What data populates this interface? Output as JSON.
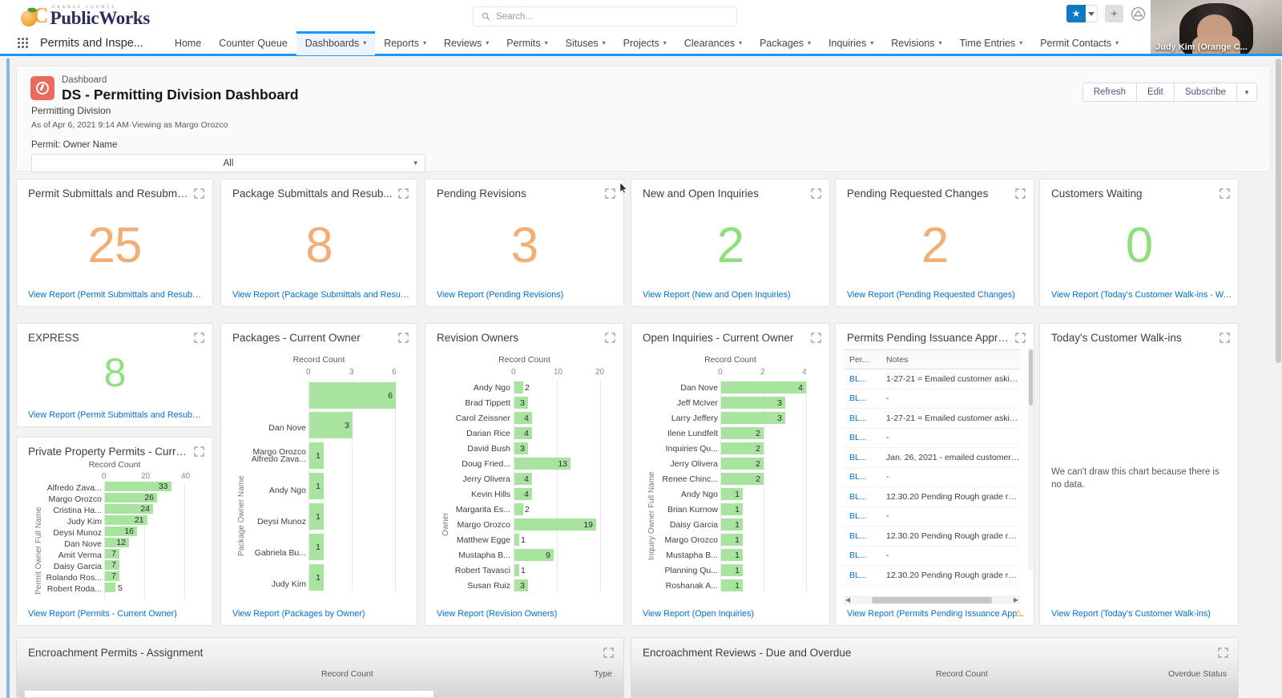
{
  "brand": {
    "sup": "ORANGE COUNTY",
    "name_part1": "Public",
    "name_part2": "Works",
    "c": "C"
  },
  "global_header": {
    "search_placeholder": "Search...",
    "icons": [
      "star-icon",
      "caret-down-icon",
      "plus-icon",
      "help-icon"
    ]
  },
  "video_overlay": {
    "participant": "Judy Kim (Orange C..."
  },
  "nav": {
    "app_name": "Permits and Inspe...",
    "items": [
      {
        "label": "Home",
        "has_caret": false,
        "active": false
      },
      {
        "label": "Counter Queue",
        "has_caret": false,
        "active": false
      },
      {
        "label": "Dashboards",
        "has_caret": true,
        "active": true
      },
      {
        "label": "Reports",
        "has_caret": true,
        "active": false
      },
      {
        "label": "Reviews",
        "has_caret": true,
        "active": false
      },
      {
        "label": "Permits",
        "has_caret": true,
        "active": false
      },
      {
        "label": "Situses",
        "has_caret": true,
        "active": false
      },
      {
        "label": "Projects",
        "has_caret": true,
        "active": false
      },
      {
        "label": "Clearances",
        "has_caret": true,
        "active": false
      },
      {
        "label": "Packages",
        "has_caret": true,
        "active": false
      },
      {
        "label": "Inquiries",
        "has_caret": true,
        "active": false
      },
      {
        "label": "Revisions",
        "has_caret": true,
        "active": false
      },
      {
        "label": "Time Entries",
        "has_caret": true,
        "active": false
      },
      {
        "label": "Permit Contacts",
        "has_caret": true,
        "active": false
      }
    ]
  },
  "dashboard_header": {
    "kicker": "Dashboard",
    "title": "DS - Permitting Division Dashboard",
    "folder": "Permitting Division",
    "meta": "As of Apr 6, 2021 9:14 AM·Viewing as Margo Orozco",
    "filter_label": "Permit: Owner Name",
    "filter_value": "All",
    "actions": {
      "refresh": "Refresh",
      "edit": "Edit",
      "subscribe": "Subscribe"
    }
  },
  "metrics": [
    {
      "title": "Permit Submittals and Resubmitt...",
      "value": "25",
      "color": "orange",
      "link": "View Report (Permit Submittals and Resubmittals)"
    },
    {
      "title": "Package Submittals and Resub...",
      "value": "8",
      "color": "orange",
      "link": "View Report (Package Submittals and Resubmitt..."
    },
    {
      "title": "Pending Revisions",
      "value": "3",
      "color": "orange",
      "link": "View Report (Pending Revisions)"
    },
    {
      "title": "New and Open Inquiries",
      "value": "2",
      "color": "green",
      "link": "View Report (New and Open Inquiries)"
    },
    {
      "title": "Pending Requested Changes",
      "value": "2",
      "color": "orange",
      "link": "View Report (Pending Requested Changes)"
    },
    {
      "title": "Customers Waiting",
      "value": "0",
      "color": "green",
      "link": "View Report (Today's Customer Walk-ins - Waiti..."
    }
  ],
  "express": {
    "title": "EXPRESS",
    "value": "8",
    "color": "green",
    "link": "View Report (Permit Submittals and Resubmittal..."
  },
  "no_data_message": "We can't draw this chart because there is no data.",
  "widgets": {
    "private_property": {
      "title": "Private Property Permits - Curre...",
      "link": "View Report (Permits - Current Owner)"
    },
    "packages": {
      "title": "Packages - Current Owner",
      "link": "View Report (Packages by Owner)"
    },
    "revisions": {
      "title": "Revision Owners",
      "link": "View Report (Revision Owners)"
    },
    "inquiries": {
      "title": "Open Inquiries - Current Owner",
      "link": "View Report (Open Inquiries)"
    },
    "pending_issuance": {
      "title": "Permits Pending Issuance Appro...",
      "link": "View Report (Permits Pending Issuance App..."
    },
    "walkins": {
      "title": "Today's Customer Walk-ins",
      "link": "View Report (Today's Customer Walk-ins)"
    }
  },
  "pending_issuance_table": {
    "columns": [
      "Per...",
      "Notes"
    ],
    "rows": [
      {
        "permit": "BL...",
        "notes": "1-27-21 = Emailed customer askin..."
      },
      {
        "permit": "BL...",
        "notes": "-"
      },
      {
        "permit": "BL...",
        "notes": "1-27-21 = Emailed customer askin..."
      },
      {
        "permit": "BL...",
        "notes": "-"
      },
      {
        "permit": "BL...",
        "notes": "Jan. 26, 2021 - emailed customer ..."
      },
      {
        "permit": "BL...",
        "notes": "-"
      },
      {
        "permit": "BL...",
        "notes": "12.30.20 Pending Rough grade rel..."
      },
      {
        "permit": "BL...",
        "notes": "-"
      },
      {
        "permit": "BL...",
        "notes": "12.30.20 Pending Rough grade rel..."
      },
      {
        "permit": "BL...",
        "notes": "-"
      },
      {
        "permit": "BL...",
        "notes": "12.30.20 Pending Rough grade rel..."
      }
    ]
  },
  "bottom_row": [
    {
      "title": "Encroachment Permits - Assignment",
      "metric": "Record Count",
      "group": "Type"
    },
    {
      "title": "Encroachment Reviews - Due and Overdue",
      "metric": "Record Count",
      "group": "Overdue Status"
    }
  ],
  "chart_data": [
    {
      "type": "bar",
      "title": "Private Property Permits - Curre...",
      "xlabel": "Record Count",
      "ylabel": "Permit Owner Full Name",
      "xlim": [
        0,
        40
      ],
      "ticks": [
        0,
        20,
        40
      ],
      "orientation": "horizontal",
      "categories": [
        "Alfredo Zava...",
        "Margo Orozco",
        "Cristina Ha...",
        "Judy Kim",
        "Deysi Munoz",
        "Dan Nove",
        "Amit Verma",
        "Daisy Garcia",
        "Rolando Ros...",
        "Robert Roda..."
      ],
      "values": [
        33,
        26,
        24,
        21,
        16,
        12,
        7,
        7,
        7,
        5
      ],
      "color": "#a8e3a0"
    },
    {
      "type": "bar",
      "title": "Packages - Current Owner",
      "xlabel": "Record Count",
      "ylabel": "Package Owner Name",
      "xlim": [
        0,
        6
      ],
      "ticks": [
        0,
        3,
        6
      ],
      "orientation": "horizontal",
      "categories": [
        "Margo Orozco",
        "Dan Nove",
        "Alfredo Zava...",
        "Andy Ngo",
        "Deysi Munoz",
        "Gabriela Bu...",
        "Judy Kim"
      ],
      "values": [
        6,
        3,
        1,
        1,
        1,
        1,
        1
      ],
      "color": "#a8e3a0"
    },
    {
      "type": "bar",
      "title": "Revision Owners",
      "xlabel": "Record Count",
      "ylabel": "Owner",
      "xlim": [
        0,
        20
      ],
      "ticks": [
        0,
        10,
        20
      ],
      "orientation": "horizontal",
      "categories": [
        "Andy Ngo",
        "Brad Tippett",
        "Carol Zeissner",
        "Darian Rice",
        "David Bush",
        "Doug Fried...",
        "Jerry Olivera",
        "Kevin Hills",
        "Margarita Es...",
        "Margo Orozco",
        "Matthew Egge",
        "Mustapha B...",
        "Robert Tavasci",
        "Susan Ruiz"
      ],
      "values": [
        2,
        3,
        4,
        4,
        3,
        13,
        4,
        4,
        2,
        19,
        1,
        9,
        1,
        3
      ],
      "color": "#a8e3a0"
    },
    {
      "type": "bar",
      "title": "Open Inquiries - Current Owner",
      "xlabel": "Record Count",
      "ylabel": "Inquiry Owner Full Name",
      "xlim": [
        0,
        4
      ],
      "ticks": [
        0,
        2,
        4
      ],
      "orientation": "horizontal",
      "categories": [
        "Dan Nove",
        "Jeff McIver",
        "Larry Jeffery",
        "Ilene Lundfelt",
        "Inquiries Qu...",
        "Jerry Olivera",
        "Renee Chinc...",
        "Andy Ngo",
        "Brian Kurnow",
        "Daisy Garcia",
        "Margo Orozco",
        "Mustapha B...",
        "Planning Qu...",
        "Roshanak A..."
      ],
      "values": [
        4,
        3,
        3,
        2,
        2,
        2,
        2,
        1,
        1,
        1,
        1,
        1,
        1,
        1
      ],
      "color": "#a8e3a0"
    }
  ]
}
